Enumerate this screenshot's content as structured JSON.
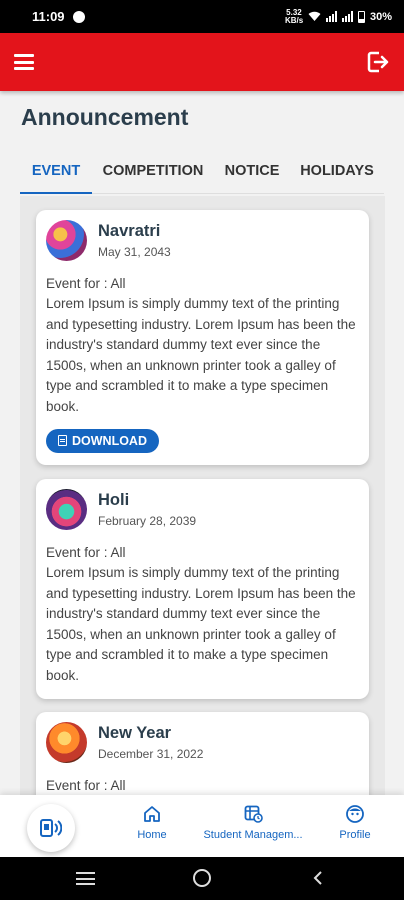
{
  "status": {
    "time": "11:09",
    "battery": "30%",
    "net": "5.32 KB/s"
  },
  "header": {
    "title": "Announcement"
  },
  "tabs": [
    {
      "label": "EVENT",
      "active": true
    },
    {
      "label": "COMPETITION",
      "active": false
    },
    {
      "label": "NOTICE",
      "active": false
    },
    {
      "label": "HOLIDAYS",
      "active": false
    }
  ],
  "events": [
    {
      "name": "Navratri",
      "date": "May 31, 2043",
      "event_for": "Event for : All",
      "description": "Lorem Ipsum is simply dummy text of the printing and typesetting industry. Lorem Ipsum has been the industry's standard dummy text ever since the 1500s, when an unknown printer took a galley of type and scrambled it to make a type specimen book.",
      "download_label": "DOWNLOAD"
    },
    {
      "name": "Holi",
      "date": "February 28, 2039",
      "event_for": "Event for : All",
      "description": "Lorem Ipsum is simply dummy text of the printing and typesetting industry. Lorem Ipsum has been the industry's standard dummy text ever since the 1500s, when an unknown printer took a galley of type and scrambled it to make a type specimen book."
    },
    {
      "name": "New Year",
      "date": "December 31, 2022",
      "event_for": "Event for : All"
    }
  ],
  "bottom_nav": [
    {
      "label": "Home",
      "icon": "home-icon"
    },
    {
      "label": "Student Managem...",
      "icon": "student-management-icon"
    },
    {
      "label": "Profile",
      "icon": "profile-icon"
    }
  ],
  "colors": {
    "primary": "#e3141b",
    "accent": "#1565c0",
    "title": "#2b3e4c"
  }
}
